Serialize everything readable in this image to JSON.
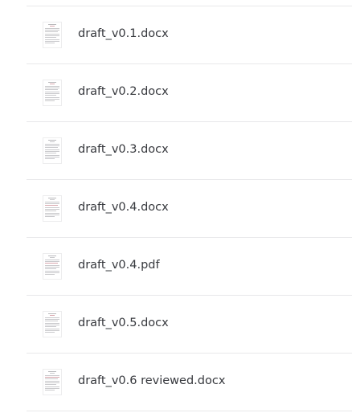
{
  "files": [
    {
      "name": "draft_v0.1.docx",
      "icon": "document-thumbnail-icon"
    },
    {
      "name": "draft_v0.2.docx",
      "icon": "document-thumbnail-icon"
    },
    {
      "name": "draft_v0.3.docx",
      "icon": "document-thumbnail-icon"
    },
    {
      "name": "draft_v0.4.docx",
      "icon": "document-thumbnail-icon"
    },
    {
      "name": "draft_v0.4.pdf",
      "icon": "document-thumbnail-icon"
    },
    {
      "name": "draft_v0.5.docx",
      "icon": "document-thumbnail-icon"
    },
    {
      "name": "draft_v0.6 reviewed.docx",
      "icon": "document-thumbnail-icon"
    }
  ],
  "colors": {
    "text": "#36383d",
    "divider": "#e8e8ea",
    "thumb_line": "#c9c9cc",
    "thumb_accent": "#d9a6ad"
  }
}
